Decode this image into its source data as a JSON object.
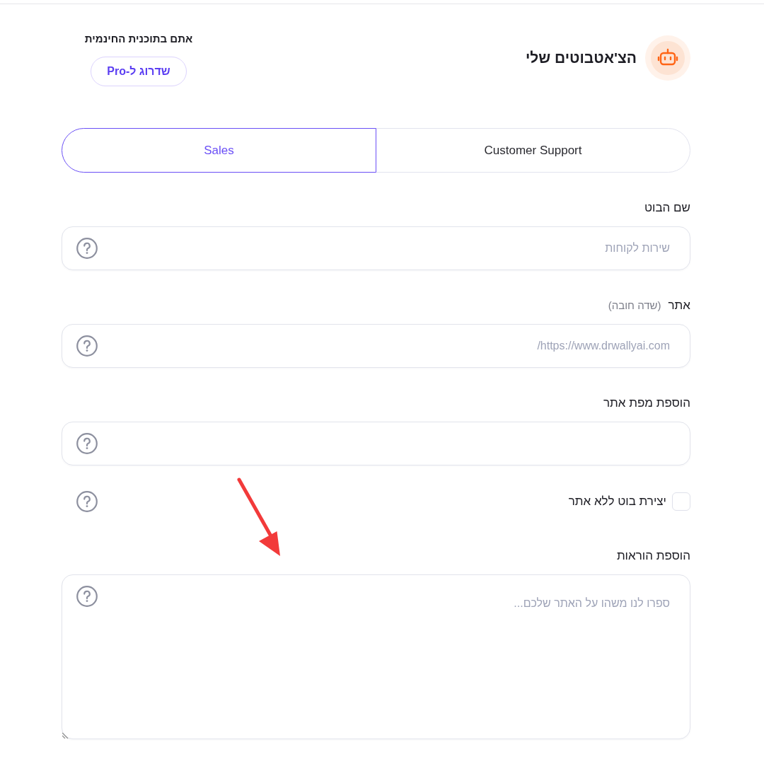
{
  "header": {
    "title": "הצ'אטבוטים שלי",
    "plan_note": "אתם בתוכנית החינמית",
    "upgrade_button": "שדרוג ל-Pro"
  },
  "tabs": [
    {
      "label": "Customer Support",
      "selected": false
    },
    {
      "label": "Sales",
      "selected": true
    }
  ],
  "form": [
    {
      "kind": "input",
      "label": "שם הבוט",
      "placeholder": "שירות לקוחות"
    },
    {
      "kind": "input",
      "label": "אתר",
      "note": "(שדה חובה)",
      "placeholder": "https://www.drwallyai.com/"
    },
    {
      "kind": "input",
      "label": "הוספת מפת אתר"
    },
    {
      "kind": "checkbox",
      "label": "יצירת בוט ללא אתר",
      "checked": false
    },
    {
      "kind": "textarea",
      "label": "הוספת הוראות",
      "placeholder": "ספרו לנו משהו על האתר שלכם..."
    }
  ]
}
